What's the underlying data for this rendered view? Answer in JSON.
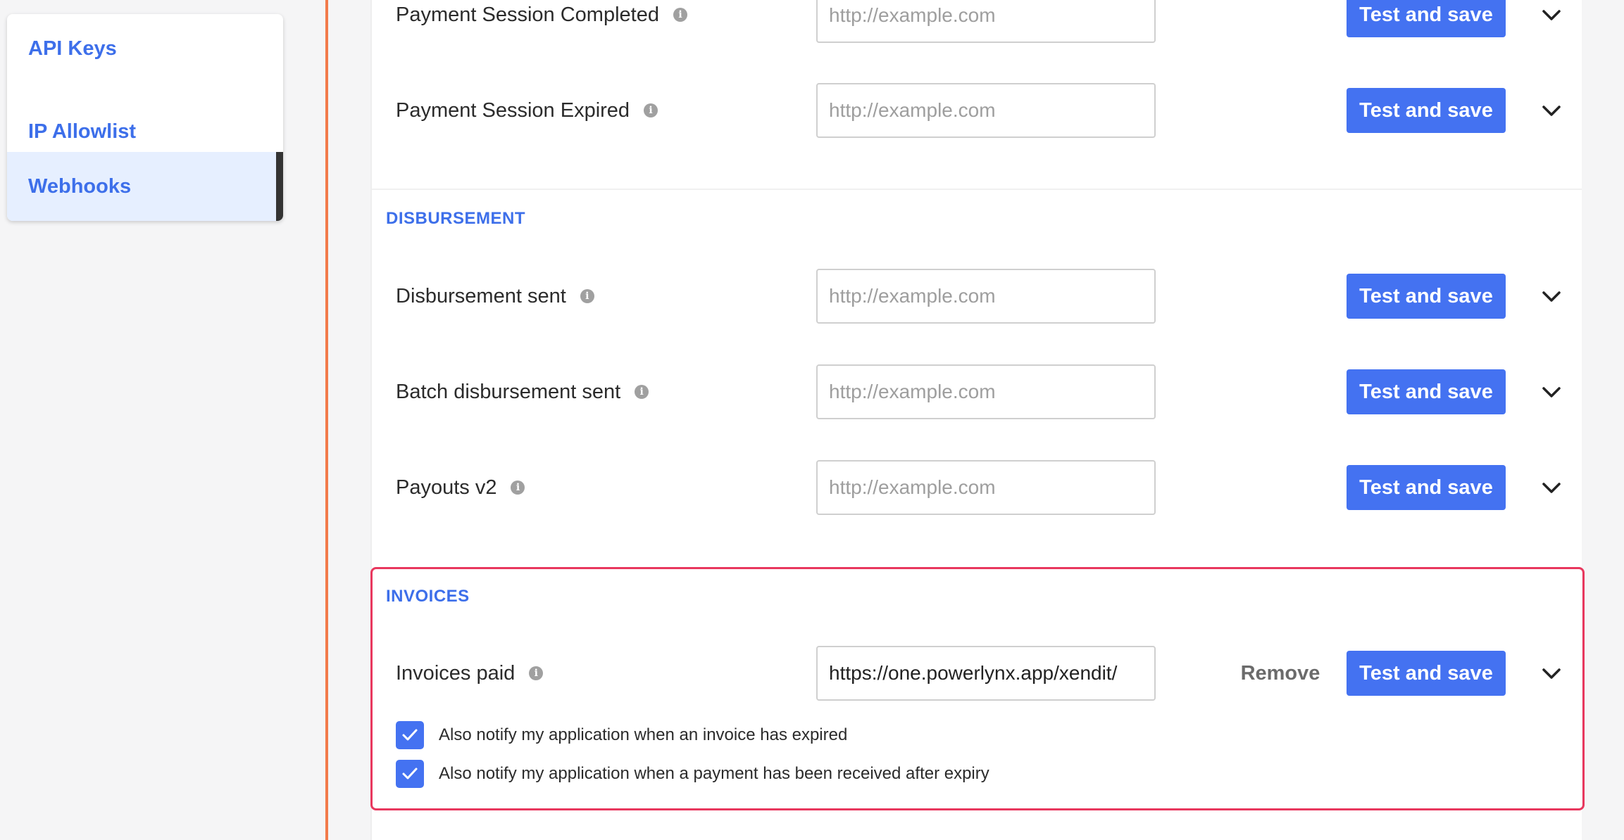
{
  "sidebar": {
    "items": [
      {
        "label": "API Keys"
      },
      {
        "label": "IP Allowlist"
      },
      {
        "label": "Webhooks"
      }
    ]
  },
  "sections": {
    "disbursement_title": "DISBURSEMENT",
    "invoices_title": "INVOICES"
  },
  "rows": {
    "payment_session_completed": {
      "label": "Payment Session Completed",
      "placeholder": "http://example.com",
      "button": "Test and save"
    },
    "payment_session_expired": {
      "label": "Payment Session Expired",
      "placeholder": "http://example.com",
      "button": "Test and save"
    },
    "disbursement_sent": {
      "label": "Disbursement sent",
      "placeholder": "http://example.com",
      "button": "Test and save"
    },
    "batch_disbursement_sent": {
      "label": "Batch disbursement sent",
      "placeholder": "http://example.com",
      "button": "Test and save"
    },
    "payouts_v2": {
      "label": "Payouts v2",
      "placeholder": "http://example.com",
      "button": "Test and save"
    },
    "invoices_paid": {
      "label": "Invoices paid",
      "value": "https://one.powerlynx.app/xendit/",
      "remove": "Remove",
      "button": "Test and save"
    }
  },
  "checkboxes": [
    {
      "label": "Also notify my application when an invoice has expired",
      "checked": true
    },
    {
      "label": "Also notify my application when a payment has been received after expiry",
      "checked": true
    }
  ],
  "icons": {
    "info": "i"
  },
  "colors": {
    "accent": "#4472f1",
    "link": "#3d6fea",
    "highlight_border": "#e8385e",
    "divider": "#f27b4b"
  }
}
